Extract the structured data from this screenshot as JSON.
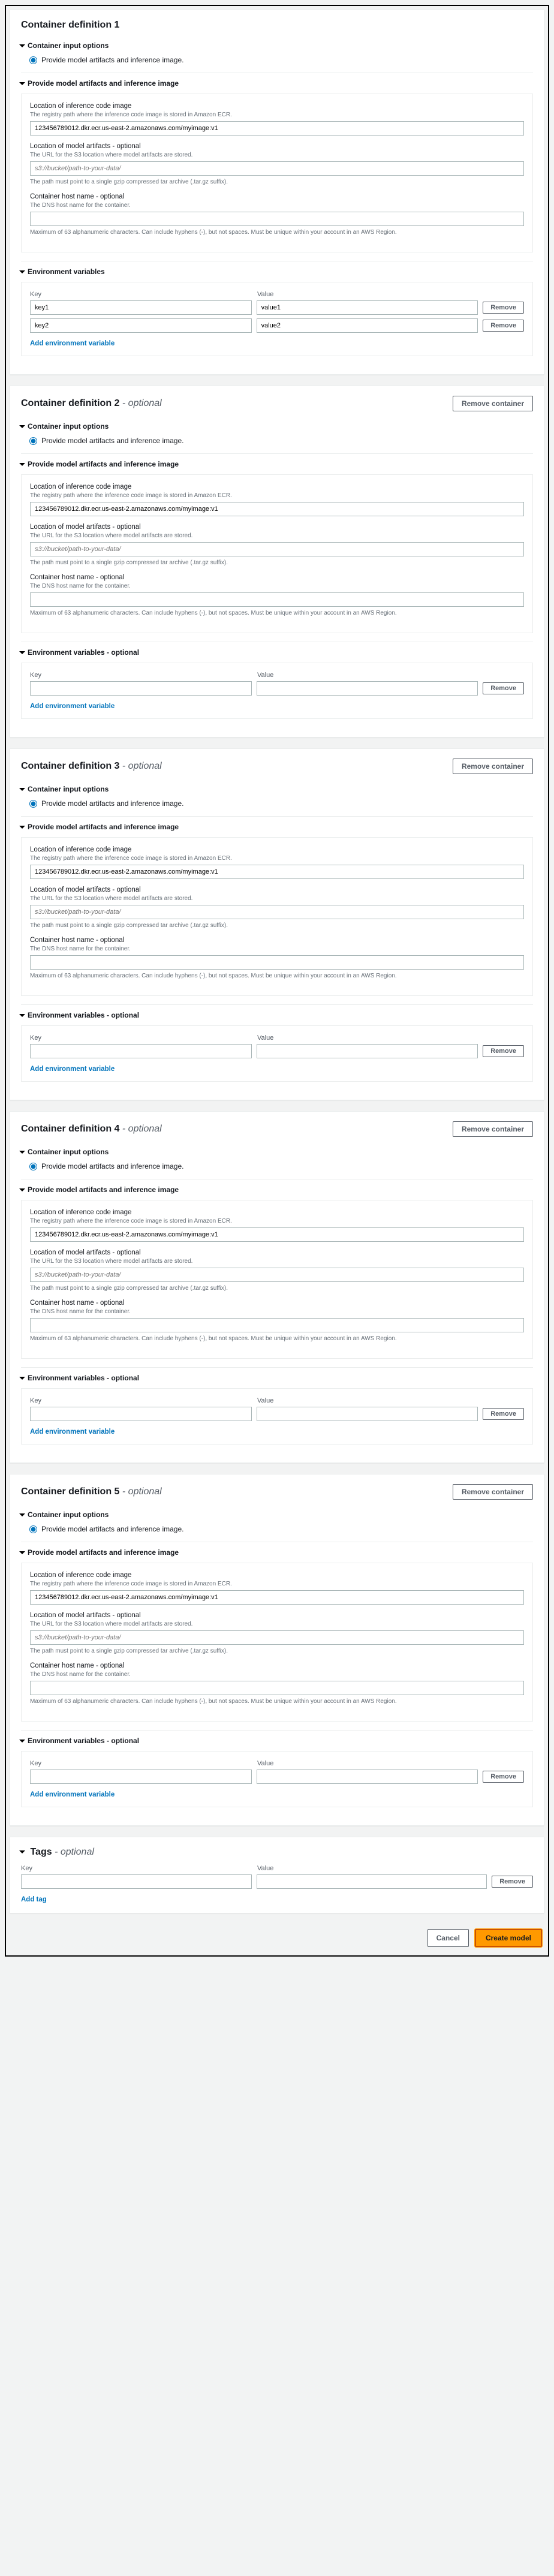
{
  "labels": {
    "optional": "optional",
    "remove_container": "Remove container",
    "remove": "Remove",
    "add_env": "Add environment variable",
    "add_tag": "Add tag",
    "cancel": "Cancel",
    "create_model": "Create model",
    "container_input_options": "Container input options",
    "radio_provide": "Provide model artifacts and inference image.",
    "provide_section": "Provide model artifacts and inference image",
    "env_section": "Environment variables",
    "env_section_optional": "Environment variables - optional",
    "key": "Key",
    "value": "Value",
    "tags_title": "Tags",
    "loc_image_label": "Location of inference code image",
    "loc_image_sub": "The registry path where the inference code image is stored in Amazon ECR.",
    "loc_artifacts_label": "Location of model artifacts - optional",
    "loc_artifacts_sub": "The URL for the S3 location where model artifacts are stored.",
    "artifacts_placeholder": "s3://bucket/path-to-your-data/",
    "artifacts_after": "The path must point to a single gzip compressed tar archive (.tar.gz suffix).",
    "host_label": "Container host name - optional",
    "host_sub": "The DNS host name for the container.",
    "host_after": "Maximum of 63 alphanumeric characters. Can include hyphens (-), but not spaces. Must be unique within your account in an AWS Region."
  },
  "containers": [
    {
      "title": "Container definition 1",
      "optional": false,
      "removable": false,
      "image": "123456789012.dkr.ecr.us-east-2.amazonaws.com/myimage:v1",
      "env_optional": false,
      "env": [
        {
          "key": "key1",
          "value": "value1"
        },
        {
          "key": "key2",
          "value": "value2"
        }
      ]
    },
    {
      "title": "Container definition 2",
      "optional": true,
      "removable": true,
      "image": "123456789012.dkr.ecr.us-east-2.amazonaws.com/myimage:v1",
      "env_optional": true,
      "env": [
        {
          "key": "",
          "value": ""
        }
      ]
    },
    {
      "title": "Container definition 3",
      "optional": true,
      "removable": true,
      "image": "123456789012.dkr.ecr.us-east-2.amazonaws.com/myimage:v1",
      "env_optional": true,
      "env": [
        {
          "key": "",
          "value": ""
        }
      ]
    },
    {
      "title": "Container definition 4",
      "optional": true,
      "removable": true,
      "image": "123456789012.dkr.ecr.us-east-2.amazonaws.com/myimage:v1",
      "env_optional": true,
      "env": [
        {
          "key": "",
          "value": ""
        }
      ]
    },
    {
      "title": "Container definition 5",
      "optional": true,
      "removable": true,
      "image": "123456789012.dkr.ecr.us-east-2.amazonaws.com/myimage:v1",
      "env_optional": true,
      "env": [
        {
          "key": "",
          "value": ""
        }
      ]
    }
  ],
  "tags": [
    {
      "key": "",
      "value": ""
    }
  ]
}
